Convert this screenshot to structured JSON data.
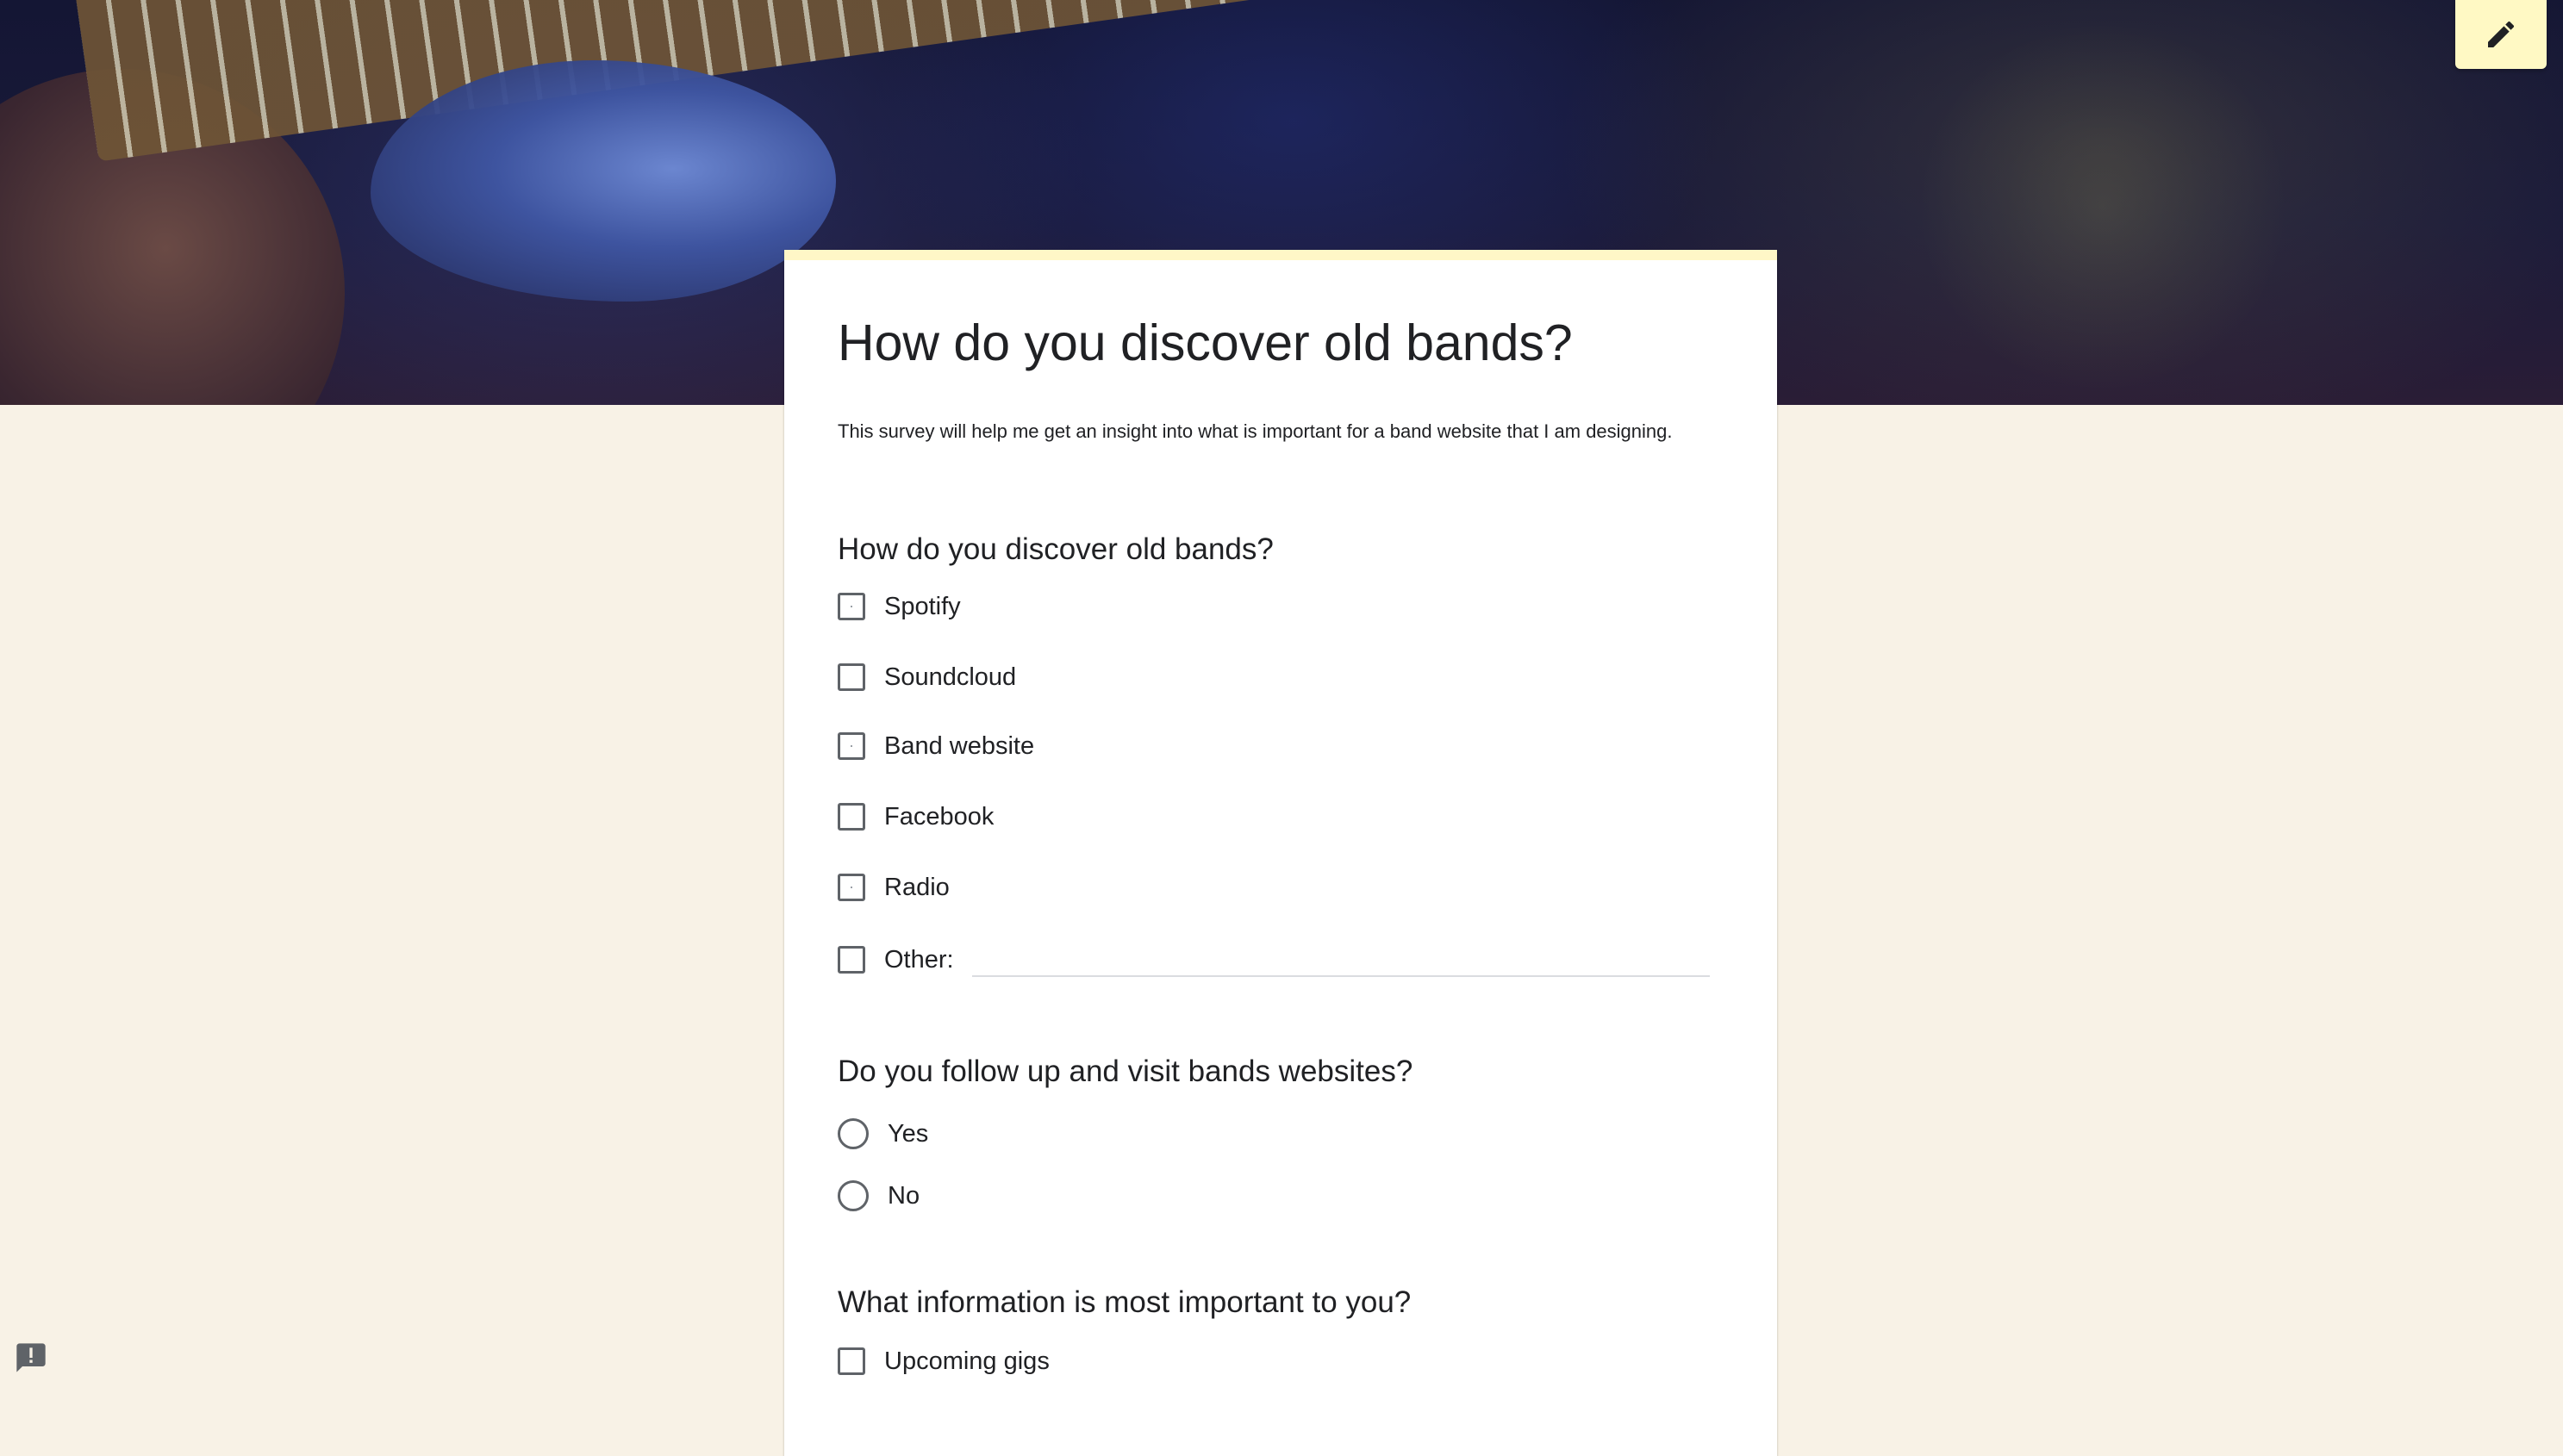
{
  "header": {
    "banner_icon": "guitar-photo",
    "edit_icon": "pencil-icon"
  },
  "form": {
    "title": "How do you discover old bands?",
    "description": "This survey will help me get an insight into what is important for a band website that I am designing."
  },
  "questions": [
    {
      "title": "How do you discover old bands?",
      "type": "checkbox",
      "options": [
        {
          "label": "Spotify",
          "checked": false
        },
        {
          "label": "Soundcloud",
          "checked": false
        },
        {
          "label": "Band website",
          "checked": false
        },
        {
          "label": "Facebook",
          "checked": false
        },
        {
          "label": "Radio",
          "checked": false
        },
        {
          "label": "Other:",
          "checked": false
        }
      ],
      "other_value": ""
    },
    {
      "title": "Do you follow up and visit bands websites?",
      "type": "radio",
      "options": [
        {
          "label": "Yes",
          "selected": false
        },
        {
          "label": "No",
          "selected": false
        }
      ]
    },
    {
      "title": "What information is most important to you?",
      "type": "checkbox",
      "options": [
        {
          "label": "Upcoming gigs",
          "checked": false
        }
      ]
    }
  ],
  "footer": {
    "report_icon": "report-feedback-icon"
  },
  "colors": {
    "page_background": "#f8f2e6",
    "card_accent": "#fff7c7",
    "edit_button": "#fff9c4",
    "control_border": "#5f6368"
  }
}
